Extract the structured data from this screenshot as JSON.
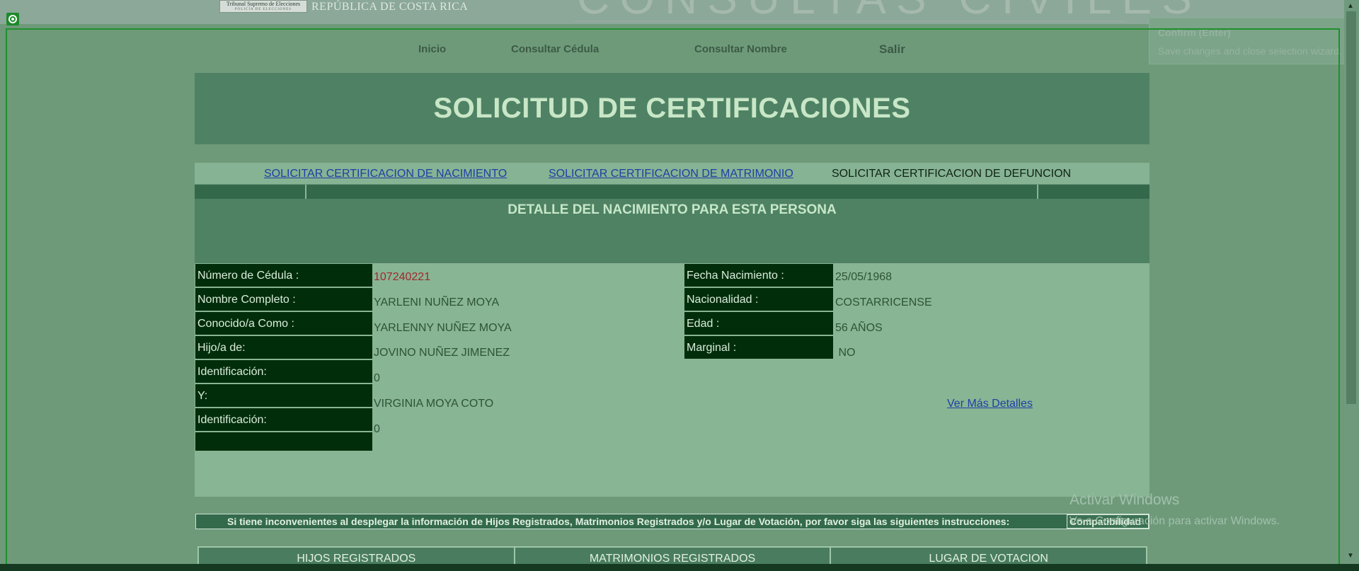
{
  "header": {
    "logo_line1": "Tribunal Supremo de Elecciones",
    "logo_line2": "POLICÍA DE ELECCIONES",
    "country": "REPÚBLICA DE COSTA RICA",
    "big_title": "CONSULTAS CIVILES"
  },
  "nav": {
    "items": [
      "Inicio",
      "Consultar Cédula",
      "Consultar Nombre",
      "Salir"
    ]
  },
  "confirm_popup": {
    "title": "Confirm (Enter)",
    "description": "Save changes and close selection wizard."
  },
  "main": {
    "title": "SOLICITUD DE CERTIFICACIONES",
    "cert_links": [
      "SOLICITAR CERTIFICACION DE NACIMIENTO",
      "SOLICITAR CERTIFICACION DE MATRIMONIO",
      "SOLICITAR CERTIFICACION DE DEFUNCION"
    ],
    "detail_title": "DETALLE DEL NACIMIENTO PARA ESTA PERSONA",
    "left_fields": [
      {
        "label": "Número de Cédula :",
        "value": "107240221"
      },
      {
        "label": "Nombre Completo :",
        "value": "YARLENI NUÑEZ MOYA"
      },
      {
        "label": "Conocido/a Como :",
        "value": "YARLENNY NUÑEZ MOYA"
      },
      {
        "label": "Hijo/a de:",
        "value": "JOVINO NUÑEZ JIMENEZ"
      },
      {
        "label": "Identificación:",
        "value": "0"
      },
      {
        "label": "Y:",
        "value": "VIRGINIA MOYA COTO"
      },
      {
        "label": "Identificación:",
        "value": "0"
      }
    ],
    "right_fields": [
      {
        "label": "Fecha Nacimiento :",
        "value": "25/05/1968"
      },
      {
        "label": "Nacionalidad :",
        "value": "COSTARRICENSE"
      },
      {
        "label": "Edad :",
        "value": "56 AÑOS"
      },
      {
        "label": "Marginal :",
        "value": " NO"
      }
    ],
    "ver_mas": "Ver Más Detalles",
    "notice": "Si tiene inconvenientes al desplegar la información de Hijos Registrados, Matrimonios Registrados y/o Lugar de Votación, por favor siga las siguientes instrucciones:",
    "compat": "Compatibilidad",
    "tabs": [
      "HIJOS REGISTRADOS",
      "MATRIMONIOS REGISTRADOS",
      "LUGAR DE VOTACION"
    ]
  },
  "windows_watermark": {
    "title": "Activar Windows",
    "desc": "Ve a Configuración para activar Windows."
  }
}
